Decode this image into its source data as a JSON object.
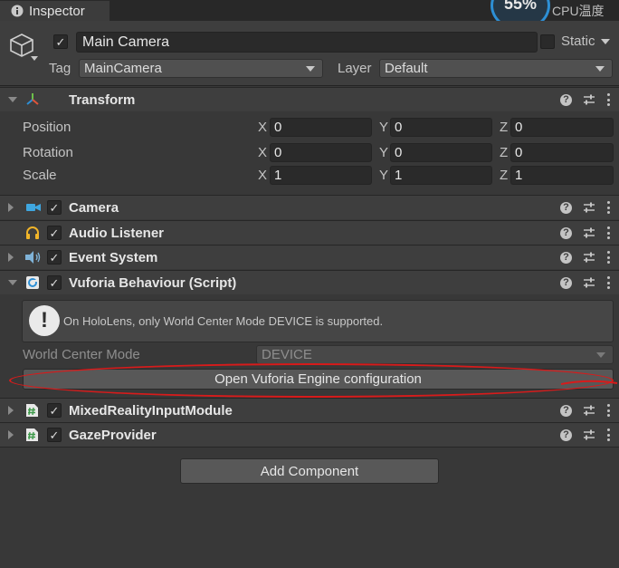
{
  "tab": {
    "label": "Inspector",
    "icon": "info-icon"
  },
  "cpu": {
    "percent": "55%",
    "label": "CPU温度"
  },
  "header": {
    "active": true,
    "name": "Main Camera",
    "static_label": "Static",
    "static_checked": false,
    "tag_label": "Tag",
    "tag_value": "MainCamera",
    "layer_label": "Layer",
    "layer_value": "Default"
  },
  "transform": {
    "title": "Transform",
    "rows": [
      {
        "label": "Position",
        "x": "0",
        "y": "0",
        "z": "0"
      },
      {
        "label": "Rotation",
        "x": "0",
        "y": "0",
        "z": "0"
      },
      {
        "label": "Scale",
        "x": "1",
        "y": "1",
        "z": "1"
      }
    ],
    "axis": {
      "x": "X",
      "y": "Y",
      "z": "Z"
    }
  },
  "components": [
    {
      "title": "Camera",
      "icon": "camera-icon",
      "enabled": true
    },
    {
      "title": "Audio Listener",
      "icon": "headphones-icon",
      "enabled": true
    },
    {
      "title": "Event System",
      "icon": "event-system-icon",
      "enabled": true
    },
    {
      "title": "Vuforia Behaviour (Script)",
      "icon": "vuforia-icon",
      "enabled": true
    },
    {
      "title": "MixedRealityInputModule",
      "icon": "script-hash-icon",
      "enabled": true
    },
    {
      "title": "GazeProvider",
      "icon": "script-hash-icon",
      "enabled": true
    }
  ],
  "vuforia": {
    "help_text": "On HoloLens, only World Center Mode DEVICE is supported.",
    "world_center_label": "World Center Mode",
    "world_center_value": "DEVICE",
    "config_button": "Open Vuforia Engine configuration"
  },
  "add_component": "Add Component",
  "colors": {
    "background": "#383838",
    "annotation": "#d81b1b",
    "accent": "#2d8fd5"
  }
}
